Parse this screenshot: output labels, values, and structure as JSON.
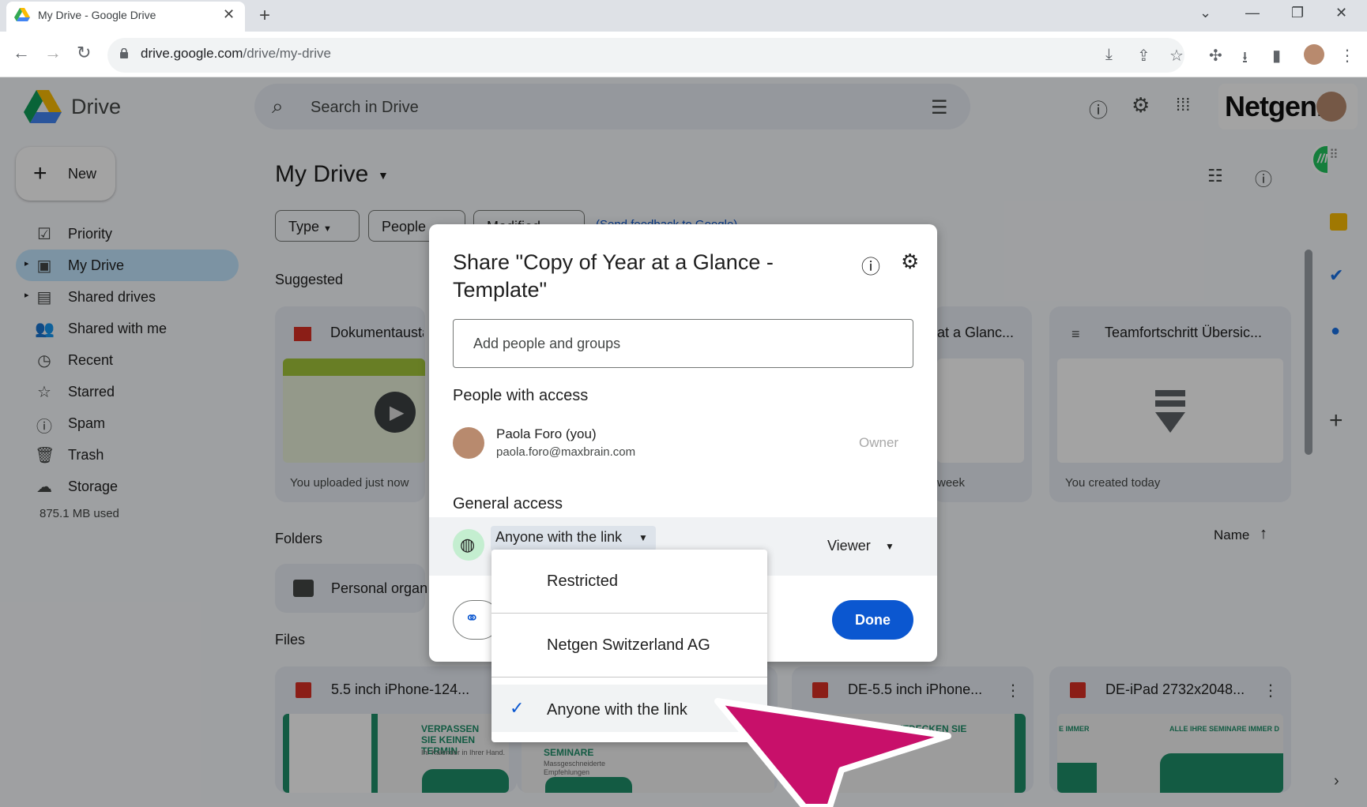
{
  "browser": {
    "tab_title": "My Drive - Google Drive",
    "url_host": "drive.google.com",
    "url_path": "/drive/my-drive"
  },
  "drive": {
    "logo_text": "Drive",
    "search_placeholder": "Search in Drive",
    "brand_text": "Netgen.",
    "new_label": "New",
    "nav": [
      {
        "label": "Priority",
        "icon": "priority-icon"
      },
      {
        "label": "My Drive",
        "icon": "my-drive-icon"
      },
      {
        "label": "Shared drives",
        "icon": "shared-drives-icon"
      },
      {
        "label": "Shared with me",
        "icon": "shared-with-me-icon"
      },
      {
        "label": "Recent",
        "icon": "clock-icon"
      },
      {
        "label": "Starred",
        "icon": "star-icon"
      },
      {
        "label": "Spam",
        "icon": "spam-icon"
      },
      {
        "label": "Trash",
        "icon": "trash-icon"
      },
      {
        "label": "Storage",
        "icon": "cloud-icon"
      }
    ],
    "storage_used": "875.1 MB used",
    "title": "My Drive",
    "chips": [
      "Type",
      "People",
      "Modified"
    ],
    "feedback_link": "(Send feedback to Google)",
    "suggested_label": "Suggested",
    "suggested": [
      {
        "title": "Dokumentausta",
        "sub": "You uploaded just now"
      },
      {
        "title": "at a Glanc...",
        "sub": "week"
      },
      {
        "title": "Teamfortschritt Übersic...",
        "sub": "You created today"
      }
    ],
    "folders_label": "Folders",
    "sort_label": "Name",
    "folder_name": "Personal organ",
    "files_label": "Files",
    "files": [
      {
        "title": "5.5 inch iPhone-124..."
      },
      {
        "title": "DE-5.5 inch iPhone..."
      },
      {
        "title": "DE-iPad 2732x2048..."
      }
    ],
    "thumb_texts": {
      "verpassen": "VERPASSEN SIE KEINEN TERMIN",
      "kalender": "Ihr Kalender in Ihrer Hand.",
      "seminare": "SEMINARE",
      "massgeschneiderte": "Massgeschneiderte Empfehlungen",
      "entdecken": "ENTDECKEN SIE",
      "immer": "E IMMER",
      "alle": "ALLE IHRE SEMINARE IMMER D"
    },
    "extension_badge": "//M"
  },
  "dialog": {
    "title": "Share \"Copy of Year at a Glance - Template\"",
    "add_placeholder": "Add people and groups",
    "people_with_access": "People with access",
    "person_name": "Paola Foro (you)",
    "person_email": "paola.foro@maxbrain.com",
    "person_role": "Owner",
    "general_access": "General access",
    "access_value": "Anyone with the link",
    "role_value": "Viewer",
    "done_label": "Done"
  },
  "menu": {
    "items": [
      {
        "label": "Restricted",
        "selected": false
      },
      {
        "label": "Netgen Switzerland AG",
        "selected": false
      },
      {
        "label": "Anyone with the link",
        "selected": true
      }
    ]
  },
  "colors": {
    "accent": "#0b57d0",
    "cursor": "#c8106a",
    "globe_bg": "#c4eed0"
  }
}
